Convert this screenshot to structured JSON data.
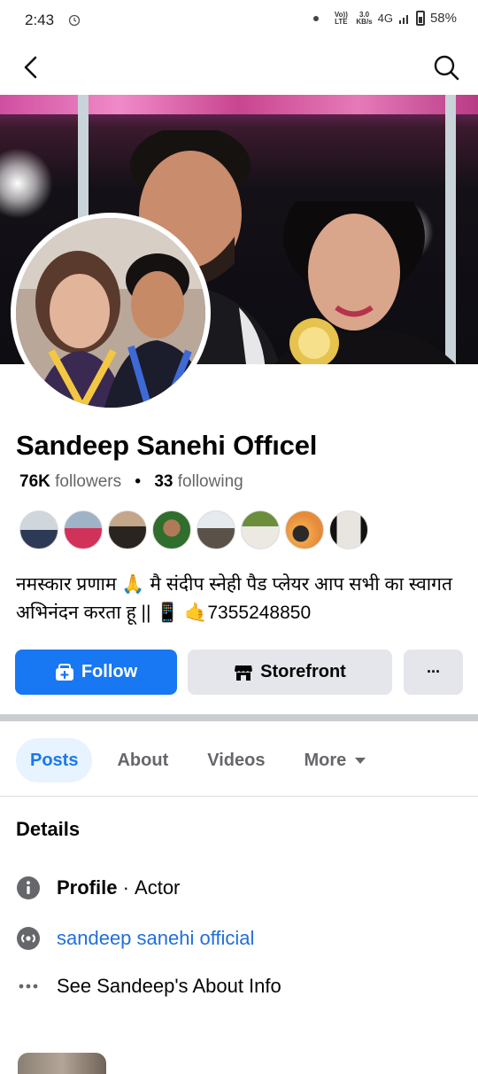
{
  "status_bar": {
    "time": "2:43",
    "net_volte": "Vo)) LTE",
    "speed_value": "3.0",
    "speed_unit": "KB/s",
    "network": "4G",
    "battery_pct": "58%"
  },
  "profile": {
    "name": "Sandeep Sanehi Offıcel",
    "followers_count": "76K",
    "followers_label": "followers",
    "separator": "•",
    "following_count": "33",
    "following_label": "following",
    "bio": "नमस्कार प्रणाम 🙏 मै संदीप स्नेही पैड प्लेयर आप सभी का स्वागत अभिनंदन करता हू || 📱 🤙7355248850"
  },
  "actions": {
    "follow_label": "Follow",
    "storefront_label": "Storefront",
    "more_label": "···"
  },
  "tabs": [
    {
      "label": "Posts",
      "active": true
    },
    {
      "label": "About",
      "active": false
    },
    {
      "label": "Videos",
      "active": false
    },
    {
      "label": "More",
      "active": false
    }
  ],
  "details": {
    "title": "Details",
    "profile_label": "Profile",
    "profile_sep": " · ",
    "profile_category": "Actor",
    "link_text": "sandeep sanehi official",
    "see_about": "See Sandeep's About Info"
  },
  "colors": {
    "accent": "#1877f2",
    "link": "#216fdb",
    "secondary_text": "#65676b",
    "button_gray": "#e4e6eb"
  },
  "icons": {
    "back": "arrow-left-icon",
    "search": "search-icon",
    "follow": "user-plus-icon",
    "storefront": "storefront-icon",
    "info": "info-icon",
    "link": "link-icon",
    "ellipsis": "ellipsis-icon"
  }
}
